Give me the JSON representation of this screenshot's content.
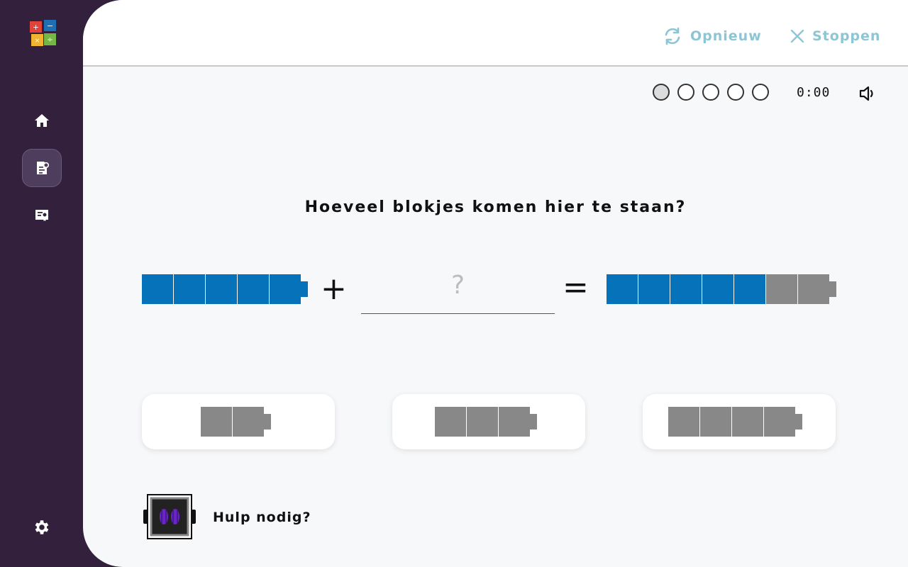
{
  "app": {
    "logo_glyphs": [
      "+",
      "−",
      "×",
      "÷"
    ]
  },
  "sidebar": {
    "items": [
      {
        "icon": "home-icon",
        "active": false
      },
      {
        "icon": "exercise-icon",
        "active": true
      },
      {
        "icon": "certificate-icon",
        "active": false
      }
    ],
    "settings_icon": "gear-icon"
  },
  "header": {
    "restart_label": "Opnieuw",
    "stop_label": "Stoppen",
    "accent_color": "#8ec5d4"
  },
  "status": {
    "progress_total": 5,
    "progress_current": 1,
    "timer": "0:00",
    "sound_icon": "speaker-icon"
  },
  "exercise": {
    "question": "Hoeveel blokjes komen hier te staan?",
    "plus": "+",
    "equals": "=",
    "placeholder": "?",
    "left_blocks": 5,
    "result_blue_blocks": 5,
    "result_gray_blocks": 2,
    "blue_color": "#0572b9",
    "gray_color": "#888888"
  },
  "options": [
    {
      "blocks": 2
    },
    {
      "blocks": 3
    },
    {
      "blocks": 4
    }
  ],
  "help": {
    "label": "Hulp nodig?"
  }
}
